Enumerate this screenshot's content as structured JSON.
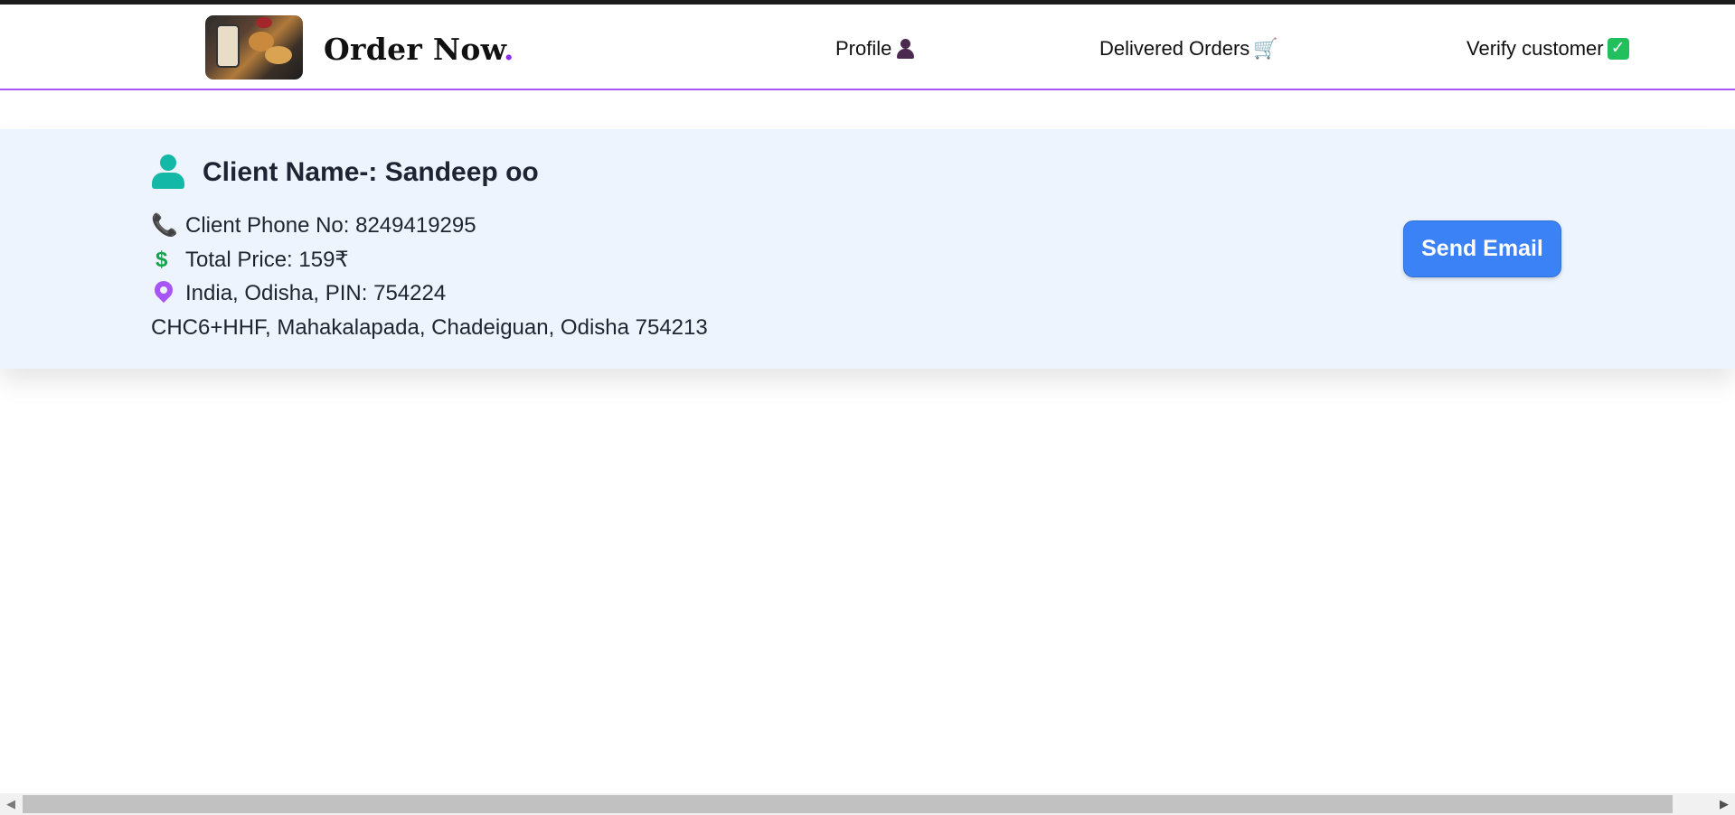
{
  "header": {
    "brand_text": "Order Now",
    "brand_dot": ".",
    "nav": [
      {
        "label": "Profile",
        "icon": "user-emoji-icon"
      },
      {
        "label": "Delivered Orders",
        "icon": "cart-emoji-icon"
      },
      {
        "label": "Verify customer",
        "icon": "check-emoji-icon"
      }
    ]
  },
  "order_card": {
    "client_name": "Client Name-: Sandeep oo",
    "phone": "Client Phone No: 8249419295",
    "total_price": "Total Price: 159₹",
    "location": "India, Odisha, PIN: 754224",
    "address": "CHC6+HHF, Mahakalapada, Chadeiguan, Odisha 754213",
    "send_email_label": "Send Email"
  },
  "colors": {
    "accent_purple": "#a855f7",
    "button_blue": "#3b82f6",
    "card_bg": "#eef4fd",
    "teal_icon": "#14b8a6",
    "phone_icon": "#f97316",
    "dollar_icon": "#16a34a"
  },
  "scrollbar": {
    "left_arrow": "◀",
    "right_arrow": "▶"
  }
}
